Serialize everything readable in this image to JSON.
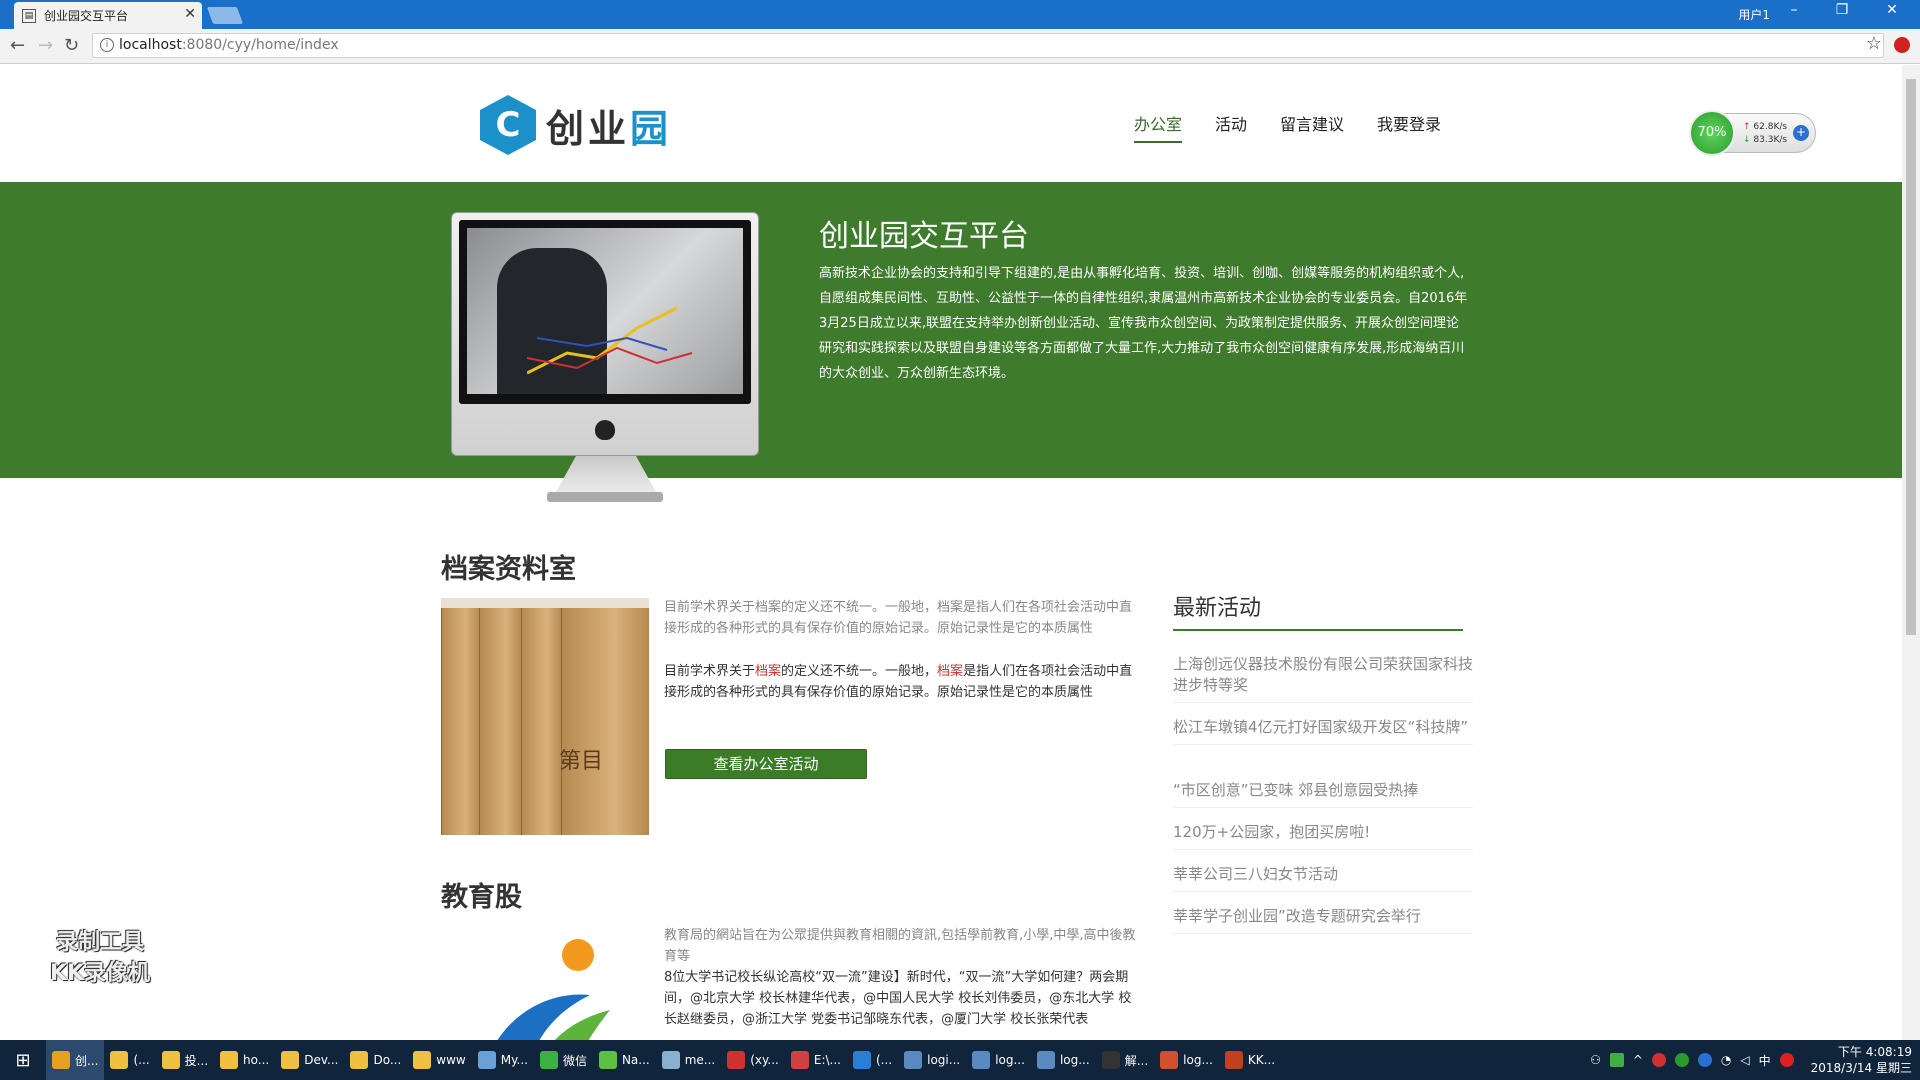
{
  "browser": {
    "tab_title": "创业园交互平台",
    "window_user": "用户1",
    "url_host": "localhost",
    "url_rest": ":8080/cyy/home/index"
  },
  "header": {
    "logo_char": "C",
    "logo_text_a": "创",
    "logo_text_b": "业",
    "logo_text_c": "园",
    "nav": [
      "办公室",
      "活动",
      "留言建议",
      "我要登录"
    ]
  },
  "net_widget": {
    "percent": "70%",
    "up": "62.8K/s",
    "down": "83.3K/s",
    "plus": "+"
  },
  "banner": {
    "title": "创业园交互平台",
    "body": "高新技术企业协会的支持和引导下组建的,是由从事孵化培育、投资、培训、创咖、创媒等服务的机构组织或个人,自愿组成集民间性、互助性、公益性于一体的自律性组织,隶属温州市高新技术企业协会的专业委员会。自2016年3月25日成立以来,联盟在支持举办创新创业活动、宣传我市众创空间、为政策制定提供服务、开展众创空间理论研究和实践探索以及联盟自身建设等各方面都做了大量工作,大力推动了我市众创空间健康有序发展,形成海纳百川的大众创业、万众创新生态环境。"
  },
  "archive": {
    "title": "档案资料室",
    "box_label": "第目",
    "text1": "目前学术界关于档案的定义还不统一。一般地，档案是指人们在各项社会活动中直接形成的各种形式的具有保存价值的原始记录。原始记录性是它的本质属性",
    "text2_a": "目前学术界关于",
    "text2_hl1": "档案",
    "text2_b": "的定义还不统一。一般地，",
    "text2_hl2": "档案",
    "text2_c": "是指人们在各项社会活动中直接形成的各种形式的具有保存价值的原始记录。原始记录性是它的本质属性",
    "button": "查看办公室活动"
  },
  "education": {
    "title": "教育股",
    "text1": "教育局的網站旨在为公眾提供與教育相關的資訊,包括學前教育,小學,中學,高中後教育等",
    "text2": "8位大学书记校长纵论高校“双一流”建设】新时代，“双一流”大学如何建？两会期间，@北京大学 校长林建华代表，@中国人民大学 校长刘伟委员，@东北大学 校长赵继委员，@浙江大学 党委书记邹晓东代表，@厦门大学 校长张荣代表"
  },
  "news": {
    "title": "最新活动",
    "items": [
      "上海创远仪器技术股份有限公司荣获国家科技进步特等奖",
      "松江车墩镇4亿元打好国家级开发区“科技牌”",
      "“市区创意”已变味 郊县创意园受热捧",
      "120万+公园家，抱团买房啦!",
      "莘莘公司三八妇女节活动",
      "莘莘学子创业园”改造专题研究会举行"
    ]
  },
  "watermark": {
    "line1": "录制工具",
    "line2": "KK录像机"
  },
  "taskbar": {
    "items": [
      {
        "label": "创...",
        "color": "#e8a020"
      },
      {
        "label": "(...",
        "color": "#f0c040"
      },
      {
        "label": "投...",
        "color": "#f0c040"
      },
      {
        "label": "ho...",
        "color": "#f0c040"
      },
      {
        "label": "Dev...",
        "color": "#f0c040"
      },
      {
        "label": "Do...",
        "color": "#f0c040"
      },
      {
        "label": "www",
        "color": "#f0c040"
      },
      {
        "label": "My...",
        "color": "#6aa0d8"
      },
      {
        "label": "微信",
        "color": "#3cb043"
      },
      {
        "label": "Na...",
        "color": "#5cc040"
      },
      {
        "label": "me...",
        "color": "#8ab0d0"
      },
      {
        "label": "(xy...",
        "color": "#d03030"
      },
      {
        "label": "E:\\...",
        "color": "#d04040"
      },
      {
        "label": "(...",
        "color": "#2a7fd4"
      },
      {
        "label": "logi...",
        "color": "#5a8ac0"
      },
      {
        "label": "log...",
        "color": "#5a8ac0"
      },
      {
        "label": "log...",
        "color": "#5a8ac0"
      },
      {
        "label": "解...",
        "color": "#333333"
      },
      {
        "label": "log...",
        "color": "#d05030"
      },
      {
        "label": "KK...",
        "color": "#c04020"
      }
    ],
    "tray_lang": "中",
    "time": "下午 4:08:19",
    "date": "2018/3/14 星期三"
  }
}
